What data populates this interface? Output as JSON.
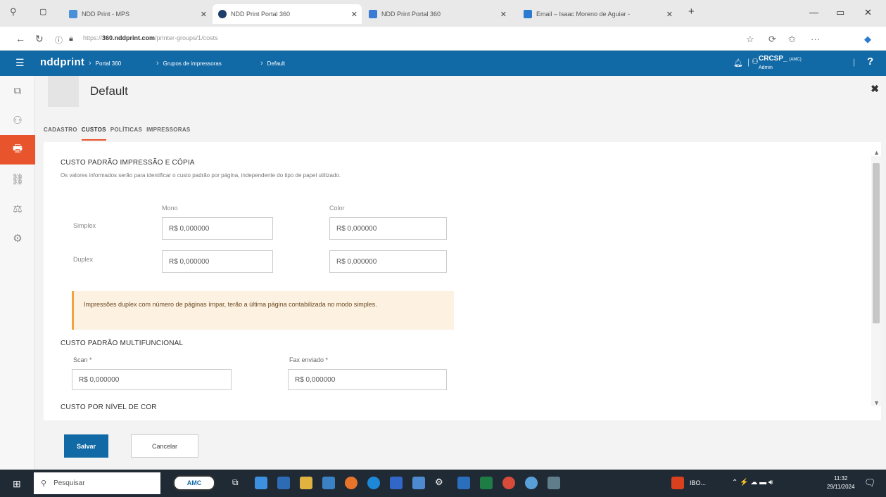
{
  "browser": {
    "tabs": [
      {
        "label": "NDD Print - MPS",
        "color": "#4a90d9"
      },
      {
        "label": "NDD Print Portal 360",
        "color": "#1e3e6b"
      },
      {
        "label": "NDD Print Portal 360",
        "color": "#3b7bd6"
      },
      {
        "label": "Email – Isaac Moreno de Aguiar -",
        "color": "#2c7bd0"
      }
    ],
    "url_prefix": "https://",
    "url_host": "360.nddprint.com",
    "url_path": "/printer-groups/1/costs"
  },
  "app": {
    "logo": "nddprint",
    "breadcrumbs": [
      "Portal 360",
      "Grupos de impressoras",
      "Default"
    ],
    "user_name": "CRCSP_",
    "user_tag": "(AMC)",
    "user_role": "Admin",
    "help": "?",
    "accent": "#1169a6",
    "active_rail": "#e8542c"
  },
  "page": {
    "title": "Default",
    "tabs": [
      "CADASTRO",
      "CUSTOS",
      "POLÍTICAS",
      "IMPRESSORAS"
    ]
  },
  "costs": {
    "section1_title": "CUSTO PADRÃO IMPRESSÃO E CÓPIA",
    "section1_desc": "Os valores informados serão para identificar o custo padrão por página, independente do tipo de papel utilizado.",
    "col_mono": "Mono",
    "col_color": "Color",
    "row_simplex": "Simplex",
    "row_duplex": "Duplex",
    "simplex_mono": "R$ 0,000000",
    "simplex_color": "R$ 0,000000",
    "duplex_mono": "R$ 0,000000",
    "duplex_color": "R$ 0,000000",
    "warning": "Impressões duplex com número de páginas ímpar, terão a última página contabilizada no modo simples.",
    "section2_title": "CUSTO PADRÃO MULTIFUNCIONAL",
    "scan_label": "Scan *",
    "scan_value": "R$ 0,000000",
    "fax_label": "Fax enviado *",
    "fax_value": "R$ 0,000000",
    "section3_title": "CUSTO POR NÍVEL DE COR"
  },
  "actions": {
    "save": "Salvar",
    "cancel": "Cancelar"
  },
  "taskbar": {
    "search_placeholder": "Pesquisar",
    "amc_label": "AMC",
    "app_label": "IBO...",
    "time": "11:32",
    "date": "29/11/2024"
  }
}
